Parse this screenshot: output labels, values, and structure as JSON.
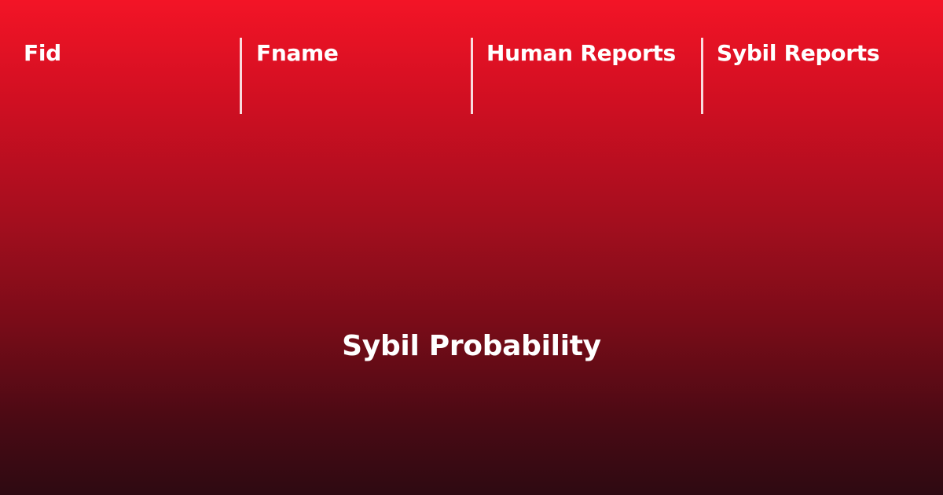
{
  "header": {
    "columns": [
      {
        "label": "Fid"
      },
      {
        "label": "Fname"
      },
      {
        "label": "Human Reports"
      },
      {
        "label": "Sybil Reports"
      }
    ]
  },
  "main": {
    "probability_label": "Sybil Probability"
  },
  "colors": {
    "gradient_top": "#f31426",
    "gradient_bottom": "#2e0a12",
    "text": "#ffffff"
  }
}
